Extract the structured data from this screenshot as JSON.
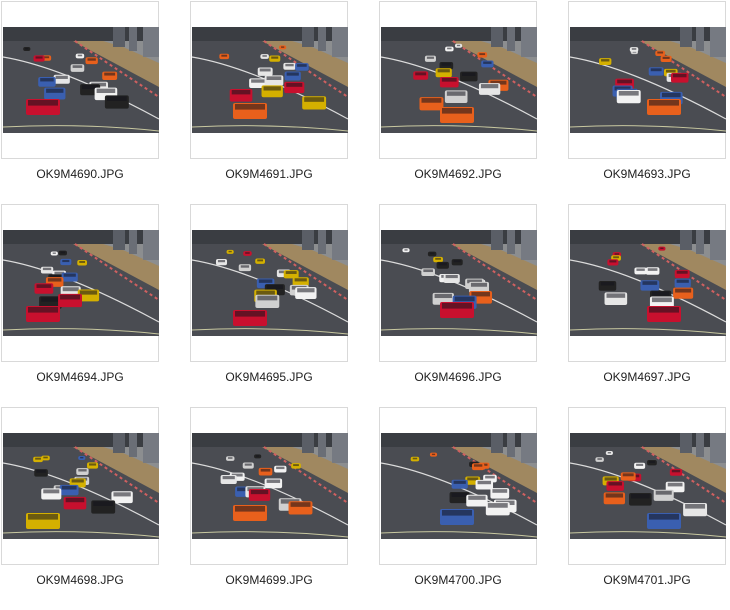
{
  "files": [
    {
      "name": "OK9M4690.JPG",
      "accent": "#c8102e"
    },
    {
      "name": "OK9M4691.JPG",
      "accent": "#e8601c"
    },
    {
      "name": "OK9M4692.JPG",
      "accent": "#e8601c"
    },
    {
      "name": "OK9M4693.JPG",
      "accent": "#e8601c"
    },
    {
      "name": "OK9M4694.JPG",
      "accent": "#c8102e"
    },
    {
      "name": "OK9M4695.JPG",
      "accent": "#c8102e"
    },
    {
      "name": "OK9M4696.JPG",
      "accent": "#c8102e"
    },
    {
      "name": "OK9M4697.JPG",
      "accent": "#c8102e"
    },
    {
      "name": "OK9M4698.JPG",
      "accent": "#d4b000"
    },
    {
      "name": "OK9M4699.JPG",
      "accent": "#e8601c"
    },
    {
      "name": "OK9M4700.JPG",
      "accent": "#3a5fb0"
    },
    {
      "name": "OK9M4701.JPG",
      "accent": "#3a5fb0"
    }
  ],
  "colors": {
    "track": "#4a4c52",
    "grass": "#a08860",
    "wall": "#8a8f96",
    "sky": "#3a3d42"
  }
}
